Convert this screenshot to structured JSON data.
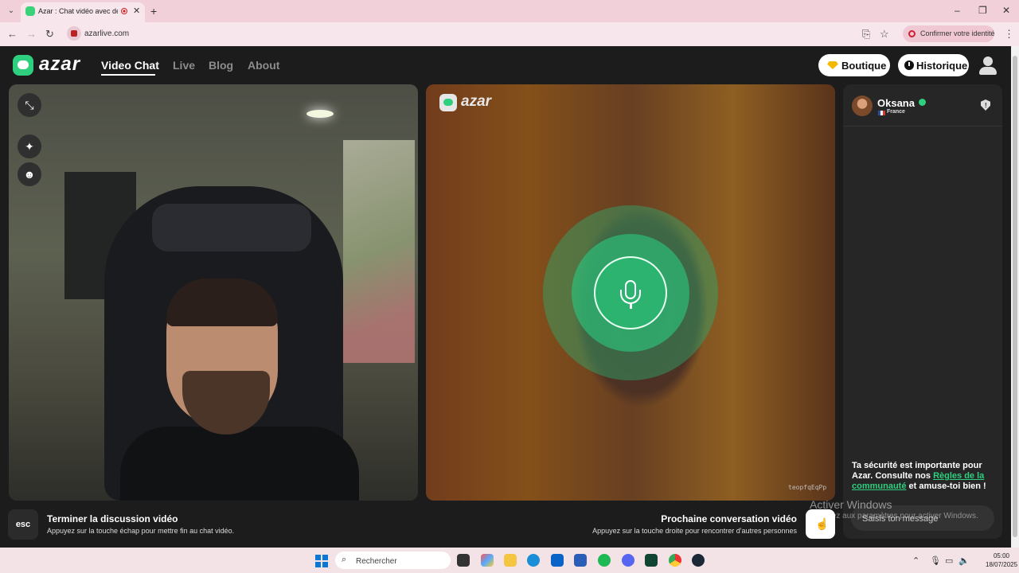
{
  "browser": {
    "tab_title": "Azar : Chat vidéo avec de n",
    "url": "azarlive.com",
    "confirm_identity": "Confirmer votre identité"
  },
  "header": {
    "logo": "azar",
    "nav": [
      {
        "label": "Video Chat",
        "active": true
      },
      {
        "label": "Live",
        "active": false
      },
      {
        "label": "Blog",
        "active": false
      },
      {
        "label": "About",
        "active": false
      }
    ],
    "boutique_label": "Boutique",
    "historique_label": "Historique"
  },
  "remote_video": {
    "watermark": "azar",
    "session_code": "teopfqEqPp",
    "mic_color": "#2cb36f"
  },
  "chat": {
    "partner_name": "Oksana",
    "partner_country": "France",
    "safety_prefix": "Ta sécurité est importante pour Azar. Consulte nos ",
    "safety_link": "Règles de la communauté",
    "safety_suffix": " et amuse-toi bien !",
    "input_placeholder": "Saisis ton message"
  },
  "bottom": {
    "esc_key": "esc",
    "end_title": "Terminer la discussion vidéo",
    "end_sub": "Appuyez sur la touche échap pour mettre fin au chat vidéo.",
    "next_title": "Prochaine conversation vidéo",
    "next_sub": "Appuyez sur la touche droite pour rencontrer d'autres personnes"
  },
  "windows_watermark": {
    "title": "Activer Windows",
    "sub": "Accédez aux paramètres pour activer Windows."
  },
  "taskbar": {
    "search_placeholder": "Rechercher",
    "time": "05:00",
    "date": "18/07/2025"
  },
  "colors": {
    "accent": "#2ed07f",
    "app_bg": "#1c1c1c",
    "browser_tab_bg": "#f2d0da"
  }
}
